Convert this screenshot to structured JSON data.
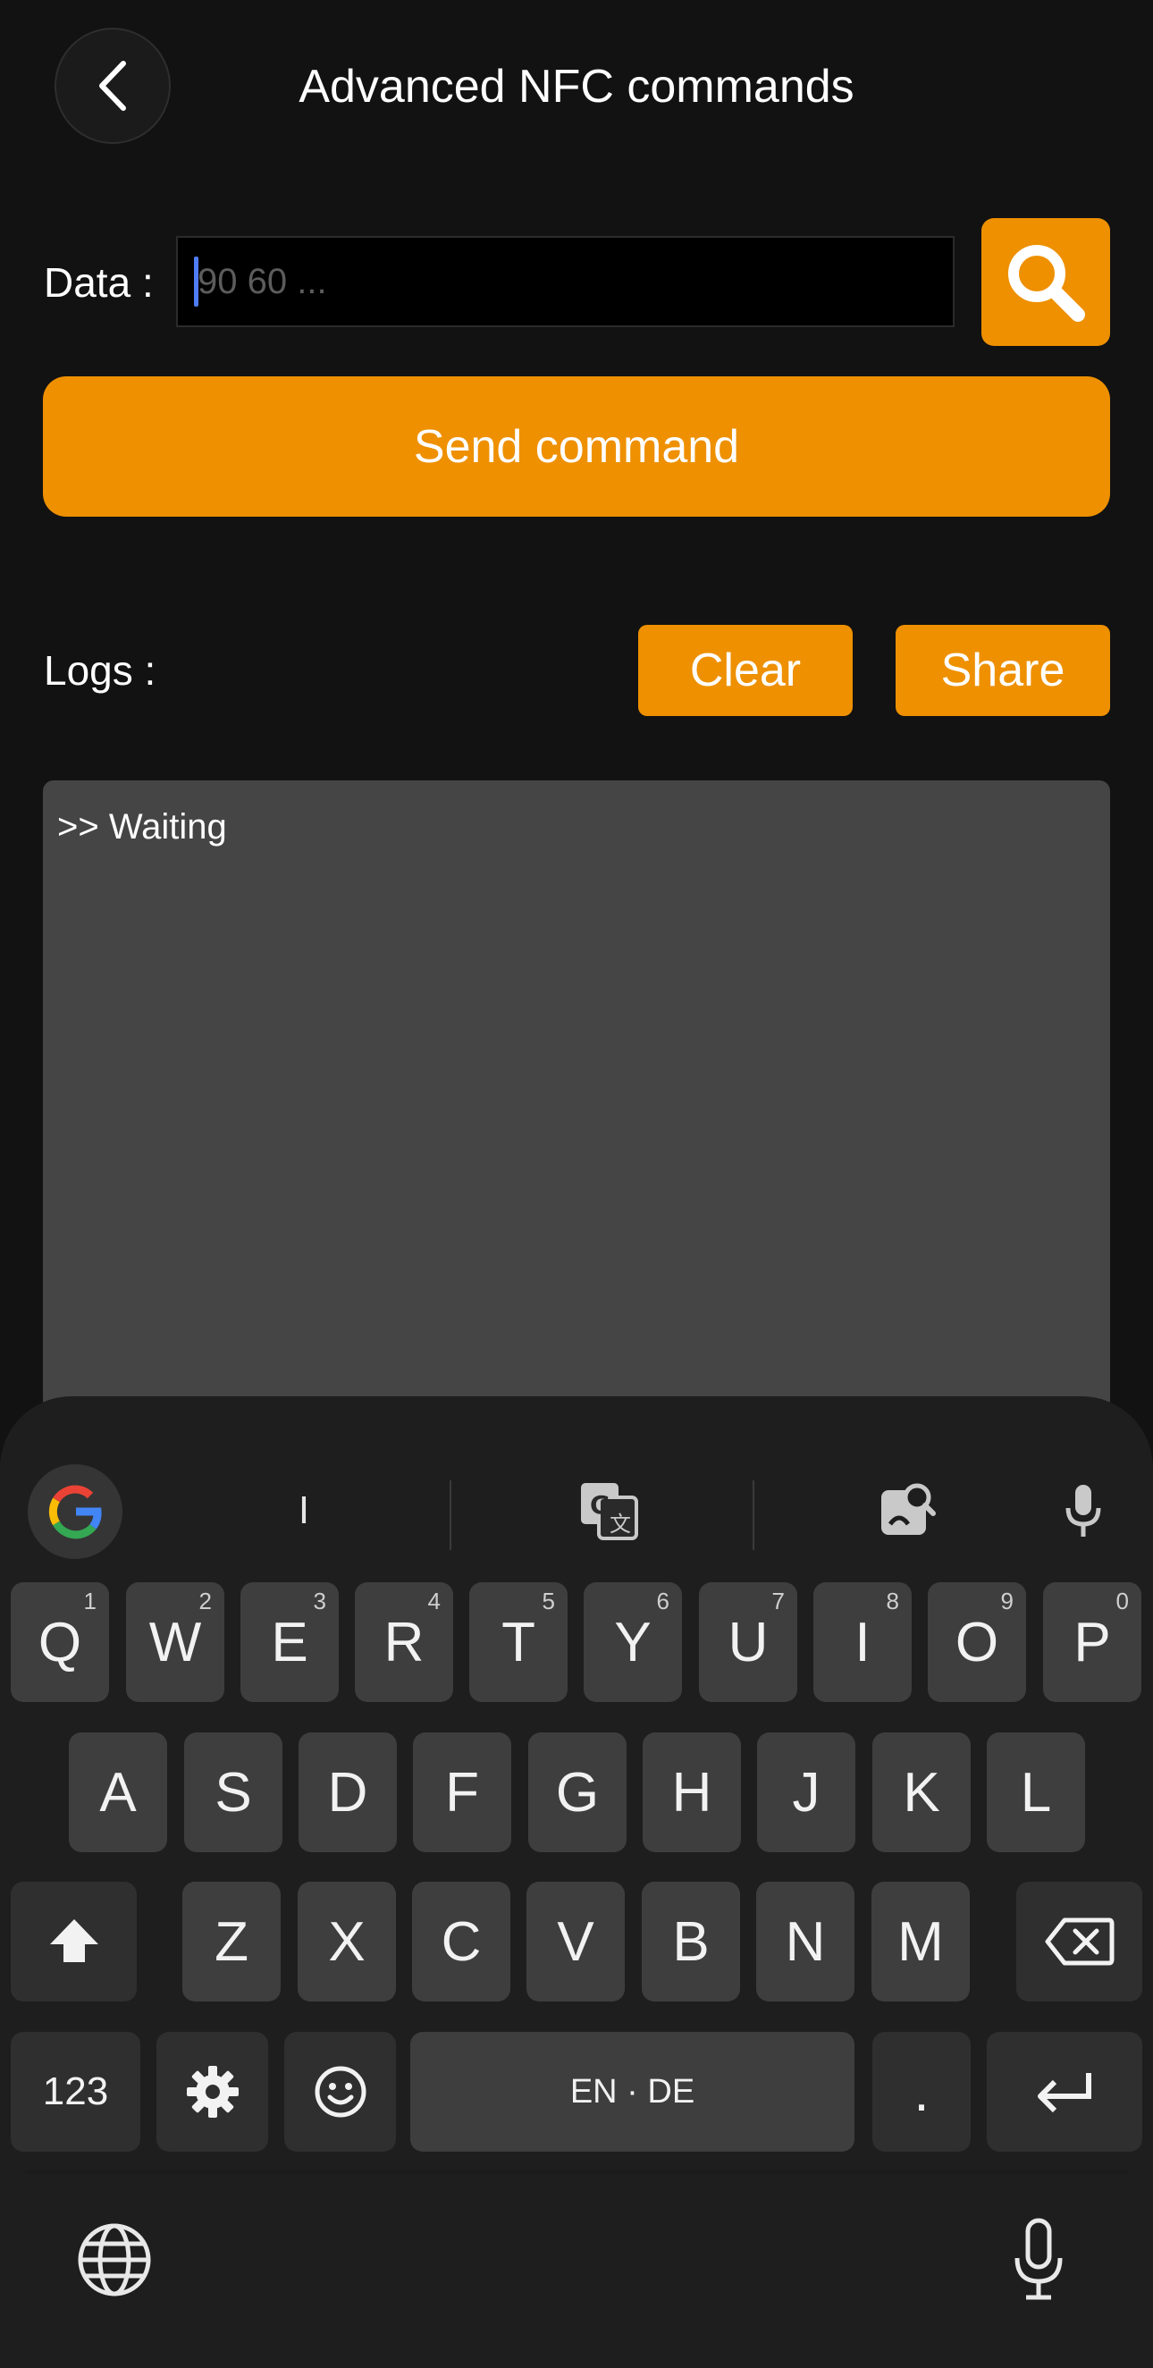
{
  "header": {
    "title": "Advanced NFC commands",
    "back_icon": "chevron-left-icon"
  },
  "data_row": {
    "label": "Data :",
    "input_value": "",
    "input_placeholder": "90 60 ...",
    "search_icon": "search-icon"
  },
  "send_button": {
    "label": "Send command"
  },
  "logs": {
    "label": "Logs :",
    "clear_label": "Clear",
    "share_label": "Share",
    "content": ">> Waiting"
  },
  "keyboard": {
    "suggestion": "I",
    "row1": [
      {
        "key": "Q",
        "hint": "1"
      },
      {
        "key": "W",
        "hint": "2"
      },
      {
        "key": "E",
        "hint": "3"
      },
      {
        "key": "R",
        "hint": "4"
      },
      {
        "key": "T",
        "hint": "5"
      },
      {
        "key": "Y",
        "hint": "6"
      },
      {
        "key": "U",
        "hint": "7"
      },
      {
        "key": "I",
        "hint": "8"
      },
      {
        "key": "O",
        "hint": "9"
      },
      {
        "key": "P",
        "hint": "0"
      }
    ],
    "row2": [
      "A",
      "S",
      "D",
      "F",
      "G",
      "H",
      "J",
      "K",
      "L"
    ],
    "row3": [
      "Z",
      "X",
      "C",
      "V",
      "B",
      "N",
      "M"
    ],
    "numbers_label": "123",
    "space_label": "EN · DE",
    "period_label": "."
  },
  "colors": {
    "accent": "#ee9000",
    "background": "#121212",
    "log_background": "#454545",
    "key_background": "#3e3e3e",
    "caret": "#4f7df5"
  }
}
